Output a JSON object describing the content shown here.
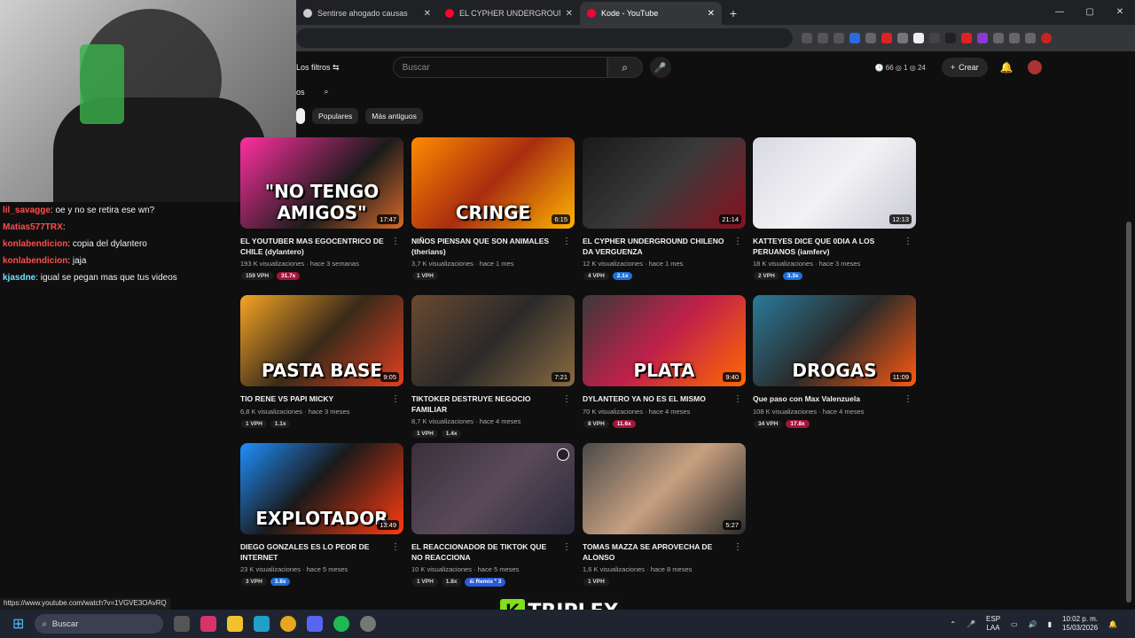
{
  "browser": {
    "tabs": [
      {
        "title": "Sentirse ahogado causas",
        "color": "#cccccc"
      },
      {
        "title": "EL CYPHER UNDERGROUND CH",
        "color": "#ff0033"
      },
      {
        "title": "Kode - YouTube",
        "color": "#ff0033"
      }
    ],
    "new_tab": "+",
    "window_controls": [
      "—",
      "▢",
      "✕"
    ]
  },
  "youtube": {
    "filters_label": "Los filtros ⇆",
    "search_placeholder": "Buscar",
    "search_icon": "⌕",
    "mic_icon": "🎤",
    "stats": "🕒 66 ◎ 1 ◎ 24",
    "create_label": "Crear",
    "bell_icon": "🔔",
    "subnav": [
      "os",
      "⌕"
    ],
    "chips": [
      "",
      "Populares",
      "Más antiguos"
    ]
  },
  "videos": [
    {
      "title": "EL YOUTUBER MAS EGOCENTRICO DE CHILE (dylantero)",
      "meta": "193 K visualizaciones · hace 3 semanas",
      "duration": "17:47",
      "overlay": "\"NO TENGO AMIGOS\"",
      "badges": [
        {
          "t": "159 VPH",
          "c": ""
        },
        {
          "t": "31.7x",
          "c": "red"
        }
      ],
      "bg": "linear-gradient(135deg,#ff2fa0,#1b1b1b 60%,#d86a2a)"
    },
    {
      "title": "NIÑOS PIENSAN QUE SON ANIMALES (therians)",
      "meta": "3,7 K visualizaciones · hace 1 mes",
      "duration": "6:15",
      "overlay": "CRINGE",
      "badges": [
        {
          "t": "1 VPH",
          "c": ""
        }
      ],
      "bg": "linear-gradient(135deg,#ff8a00,#a82d10 50%,#ffb400)"
    },
    {
      "title": "EL CYPHER UNDERGROUND CHILENO DA VERGUENZA",
      "meta": "12 K visualizaciones · hace 1 mes",
      "duration": "21:14",
      "overlay": "",
      "badges": [
        {
          "t": "4 VPH",
          "c": ""
        },
        {
          "t": "2.1x",
          "c": "blue"
        }
      ],
      "bg": "linear-gradient(135deg,#1a1a1a,#3a3a3a 50%,#8a1020)"
    },
    {
      "title": "KATTEYES DICE QUE 0DIA A LOS PERUANOS (iamferv)",
      "meta": "18 K visualizaciones · hace 3 meses",
      "duration": "12:13",
      "overlay": "",
      "badges": [
        {
          "t": "2 VPH",
          "c": ""
        },
        {
          "t": "3.3x",
          "c": "blue"
        }
      ],
      "bg": "linear-gradient(135deg,#d8d8e0,#f2f2f6 50%,#c9c9d2)"
    },
    {
      "title": "TIO RENE VS PAPI MICKY",
      "meta": "6,8 K visualizaciones · hace 3 meses",
      "duration": "9:05",
      "overlay": "PASTA BASE",
      "badges": [
        {
          "t": "1 VPH",
          "c": ""
        },
        {
          "t": "1.1x",
          "c": ""
        }
      ],
      "bg": "linear-gradient(135deg,#f5a623,#3a2a1a 50%,#e24020)"
    },
    {
      "title": "TIKTOKER DESTRUYE NEGOCIO FAMILIAR",
      "meta": "8,7 K visualizaciones · hace 4 meses",
      "duration": "7:21",
      "overlay": "",
      "badges": [
        {
          "t": "1 VPH",
          "c": ""
        },
        {
          "t": "1.4x",
          "c": ""
        }
      ],
      "bg": "linear-gradient(135deg,#6b4a30,#2a2a2a 50%,#8b6a40)"
    },
    {
      "title": "DYLANTERO YA NO ES EL MISMO",
      "meta": "70 K visualizaciones · hace 4 meses",
      "duration": "9:40",
      "overlay": "PLATA",
      "badges": [
        {
          "t": "8 VPH",
          "c": ""
        },
        {
          "t": "11.6x",
          "c": "red"
        }
      ],
      "bg": "linear-gradient(135deg,#3a3a3a,#c0204a 50%,#ff6a00)"
    },
    {
      "title": "Que paso con Max Valenzuela",
      "meta": "108 K visualizaciones · hace 4 meses",
      "duration": "11:09",
      "overlay": "DROGAS",
      "badges": [
        {
          "t": "34 VPH",
          "c": ""
        },
        {
          "t": "17.8x",
          "c": "red"
        }
      ],
      "bg": "linear-gradient(135deg,#2a7a9a,#2a2a2a 50%,#ff5a10)"
    },
    {
      "title": "DIEGO GONZALES ES LO PEOR DE INTERNET",
      "meta": "23 K visualizaciones · hace 5 meses",
      "duration": "13:49",
      "overlay": "EXPLOTADOR",
      "badges": [
        {
          "t": "3 VPH",
          "c": ""
        },
        {
          "t": "3.8x",
          "c": "blue"
        }
      ],
      "bg": "linear-gradient(135deg,#1e90ff,#1a1a1a 45%,#ff3b10)"
    },
    {
      "title": "EL REACCIONADOR DE TIKTOK QUE NO REACCIONA",
      "meta": "10 K visualizaciones · hace 5 meses",
      "duration": "",
      "overlay": "",
      "badges": [
        {
          "t": "1 VPH",
          "c": ""
        },
        {
          "t": "1.8x",
          "c": ""
        },
        {
          "t": "⎌ Remix ⁺ 3",
          "c": "remix"
        }
      ],
      "bg": "linear-gradient(135deg,#3a2f3a,#5a4a5a 50%,#2a2a3a)"
    },
    {
      "title": "TOMAS MAZZA SE APROVECHA DE ALONSO",
      "meta": "1,6 K visualizaciones · hace 8 meses",
      "duration": "5:27",
      "overlay": "",
      "badges": [
        {
          "t": "1 VPH",
          "c": ""
        }
      ],
      "bg": "linear-gradient(135deg,#4a4a4a,#c8a080 50%,#2a2a2a)"
    }
  ],
  "chat": [
    {
      "user": "lil_savagge",
      "msg": ": oe y no se retira ese wn?",
      "cls": "user"
    },
    {
      "user": "Matias577TRX",
      "msg": ":",
      "cls": "user"
    },
    {
      "user": "konlabendicion",
      "msg": ": copia del dylantero",
      "cls": "user"
    },
    {
      "user": "konlabendicion",
      "msg": ": jaja",
      "cls": "user"
    },
    {
      "user": "kjasdne",
      "msg": ": igual se pegan mas que tus videos",
      "cls": "user2"
    }
  ],
  "status_url": "https://www.youtube.com/watch?v=1VGVE3OAvRQ",
  "overlay_logo": {
    "k": "K",
    "text": "TRIPLEX"
  },
  "taskbar": {
    "search_label": "Buscar",
    "lang": "ESP",
    "lang2": "LAA",
    "time": "10:02 p. m.",
    "date": "15/03/2026"
  }
}
